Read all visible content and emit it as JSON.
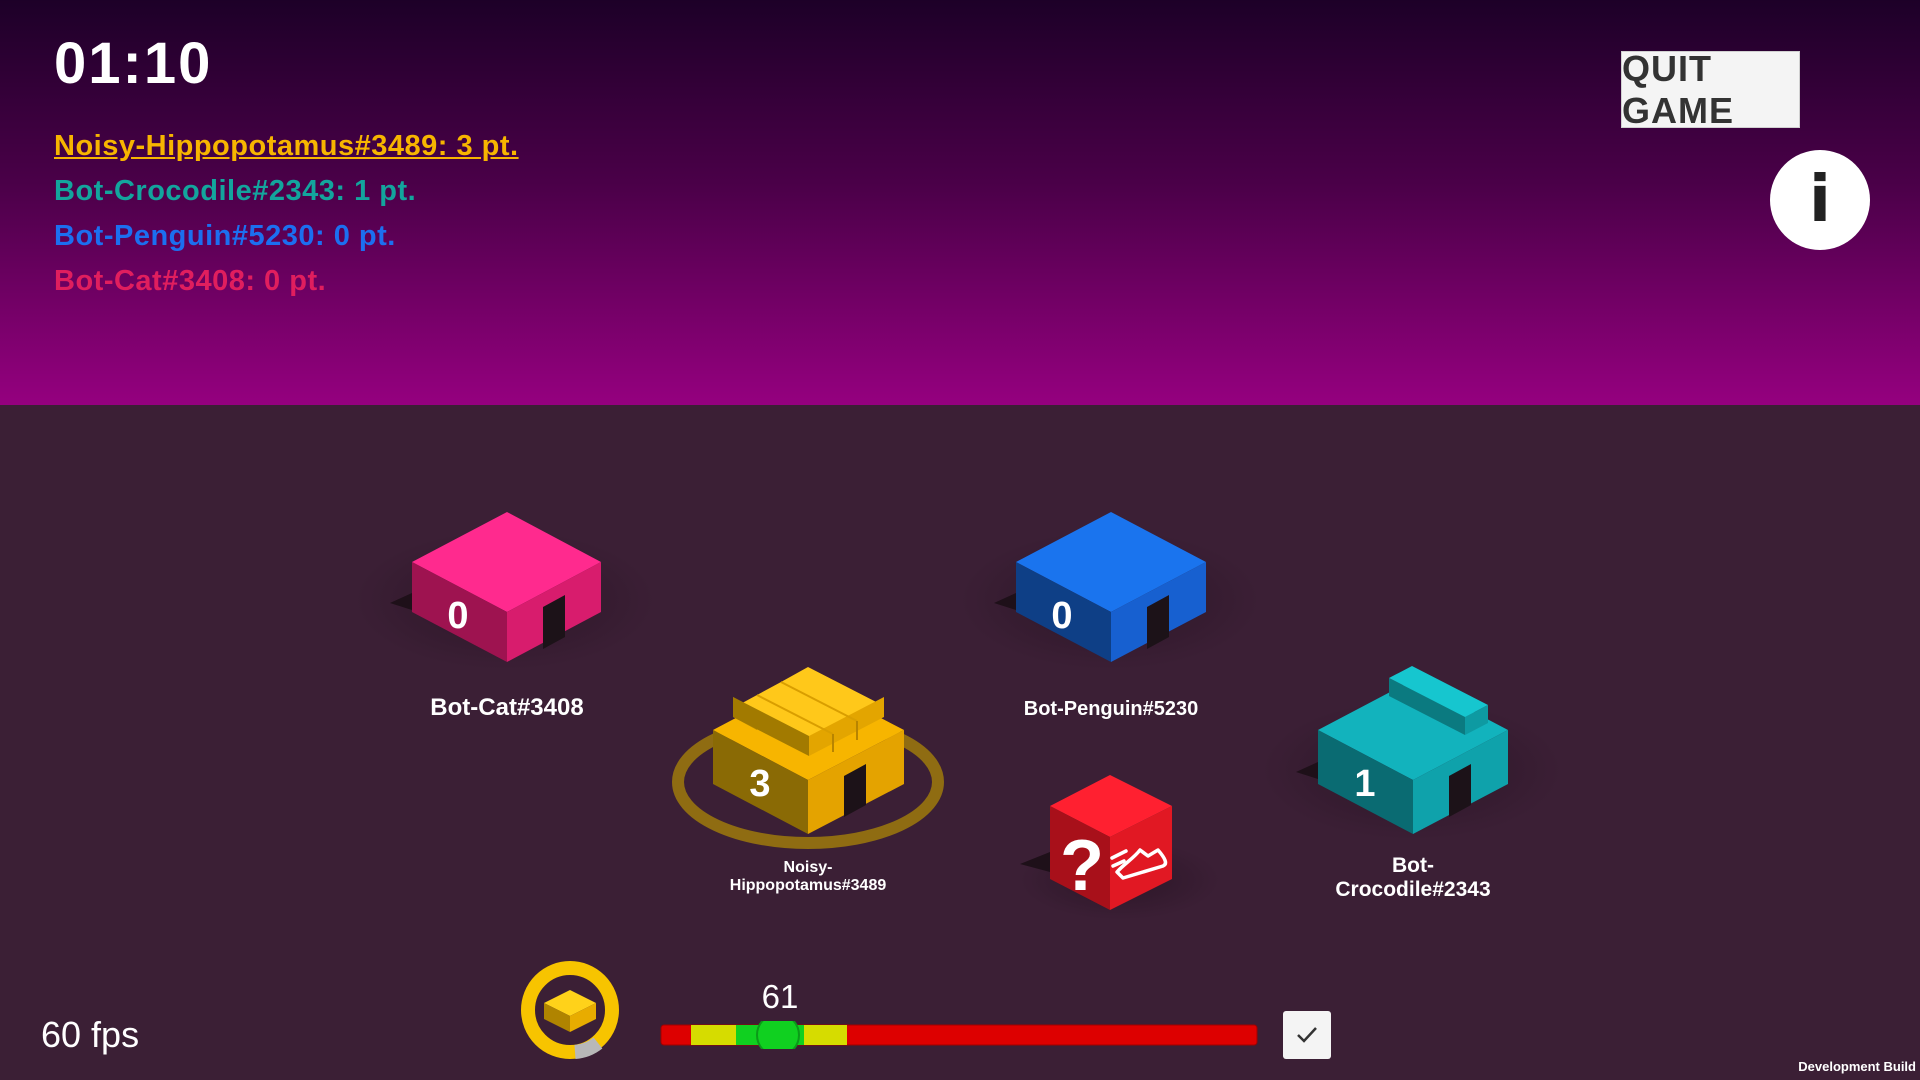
{
  "hud": {
    "timer": "01:10",
    "quit_label": "QUIT GAME",
    "info_label": "i",
    "fps": "60 fps",
    "dev_build": "Development Build"
  },
  "scoreboard": [
    {
      "text": "Noisy-Hippopotamus#3489: 3 pt.",
      "color": "#f7b500",
      "active": true
    },
    {
      "text": "Bot-Crocodile#2343: 1 pt.",
      "color": "#13a59d",
      "active": false
    },
    {
      "text": "Bot-Penguin#5230: 0 pt.",
      "color": "#1c6ff0",
      "active": false
    },
    {
      "text": "Bot-Cat#3408: 0 pt.",
      "color": "#e01e5e",
      "active": false
    }
  ],
  "houses": {
    "cat": {
      "count": "0",
      "name": "Bot-Cat#3408",
      "color": "#ff2a8e"
    },
    "penguin": {
      "count": "0",
      "name": "Bot-Penguin#5230",
      "color": "#1a74ee"
    },
    "hippo": {
      "count": "3",
      "name_line1": "Noisy-",
      "name_line2": "Hippopotamus#3489",
      "color": "#f7b500"
    },
    "croc": {
      "count": "1",
      "name_line1": "Bot-",
      "name_line2": "Crocodile#2343",
      "color": "#12b3bd"
    }
  },
  "powerup": {
    "label": "?",
    "icon": "speed-shoe-icon",
    "color": "#ff2030"
  },
  "meter": {
    "value": "61",
    "value_fraction": 0.19
  },
  "colors": {
    "accent": "#f7b500",
    "meter_red": "#dd0000",
    "meter_yellow": "#d6dc00",
    "meter_green": "#10d020"
  }
}
